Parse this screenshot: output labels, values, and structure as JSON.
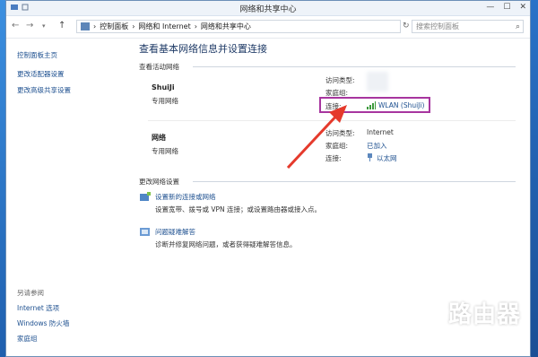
{
  "window": {
    "title": "网络和共享中心",
    "controls": [
      "—",
      "☐",
      "✕"
    ]
  },
  "nav": {
    "back": "←",
    "forward": "→",
    "up": "↑",
    "breadcrumb": [
      "控制面板",
      "网络和 Internet",
      "网络和共享中心"
    ],
    "separator": "›",
    "refresh": "↻",
    "search_placeholder": "搜索控制面板"
  },
  "sidebar": {
    "home": "控制面板主页",
    "items": [
      "更改适配器设置",
      "更改高级共享设置"
    ],
    "see_also_title": "另请参阅",
    "see_also": [
      "Internet 选项",
      "Windows 防火墙",
      "家庭组"
    ]
  },
  "main": {
    "heading": "查看基本网络信息并设置连接",
    "active_networks_title": "查看活动网络",
    "networks": [
      {
        "name": "ShuiJi",
        "type": "专用网络",
        "access_type_label": "访问类型:",
        "access_type": "",
        "homegroup_label": "家庭组:",
        "homegroup": "",
        "connection_label": "连接:",
        "connection": "WLAN (ShuiJi)"
      },
      {
        "name": "网络",
        "type": "专用网络",
        "access_type_label": "访问类型:",
        "access_type": "Internet",
        "homegroup_label": "家庭组:",
        "homegroup": "已加入",
        "connection_label": "连接:",
        "connection": "以太网"
      }
    ],
    "change_settings_title": "更改网络设置",
    "tasks": [
      {
        "link": "设置新的连接或网络",
        "desc": "设置宽带、拨号或 VPN 连接；或设置路由器或接入点。"
      },
      {
        "link": "问题疑难解答",
        "desc": "诊断并修复网络问题，或者获得疑难解答信息。"
      }
    ]
  },
  "watermark": {
    "text": "路由器",
    "url": "luyouqi.com"
  },
  "colors": {
    "link": "#1c4f8f",
    "highlight": "#a7359f",
    "arrow": "#e53a2c",
    "desktop": "#1a63b3"
  }
}
